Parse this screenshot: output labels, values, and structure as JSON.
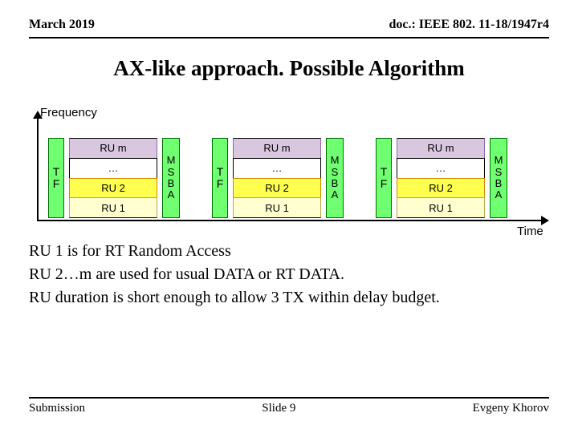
{
  "header": {
    "date": "March 2019",
    "doc": "doc.: IEEE 802. 11-18/1947r4"
  },
  "title": "AX-like approach. Possible Algorithm",
  "axes": {
    "y_label": "Frequency",
    "x_label": "Time"
  },
  "blocks": {
    "tf_top": "T",
    "tf_bottom": "F",
    "ru_m": "RU m",
    "ru_dots": "…",
    "ru_2": "RU 2",
    "ru_1": "RU 1",
    "msba_m": "M",
    "msba_s": "S",
    "msba_b": "B",
    "msba_a": "A"
  },
  "body": {
    "line1": "RU 1 is for RT Random Access",
    "line2": "RU 2…m are used for usual DATA or RT DATA.",
    "line3": "RU duration is short enough to allow 3 TX within delay budget."
  },
  "footer": {
    "left": "Submission",
    "center": "Slide 9",
    "right": "Evgeny Khorov"
  }
}
